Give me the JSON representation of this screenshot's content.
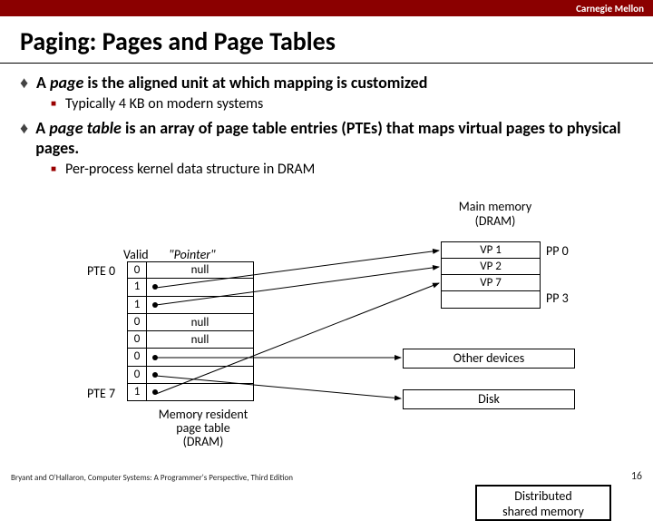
{
  "brand": "Carnegie Mellon",
  "title": "Paging: Pages and Page Tables",
  "bullets": {
    "b1a_pre": "A ",
    "b1a_em": "page",
    "b1a_post": " is the aligned unit at which mapping is customized",
    "b1a_sub": "Typically 4 KB on modern systems",
    "b1b_pre": "A ",
    "b1b_em": "page table",
    "b1b_post": " is an array of page table entries (PTEs) that maps virtual pages to physical pages.",
    "b1b_sub": "Per-process kernel data structure in DRAM"
  },
  "mm_header": {
    "l1": "Main memory",
    "l2": "(DRAM)"
  },
  "table": {
    "hdr_valid": "Valid",
    "hdr_ptr": "\"Pointer\"",
    "pte0": "PTE 0",
    "pte7": "PTE 7",
    "valid": [
      "0",
      "1",
      "1",
      "0",
      "0",
      "0",
      "0",
      "1"
    ],
    "ptr": [
      "null",
      "",
      "",
      "null",
      "null",
      "",
      "",
      ""
    ]
  },
  "pt_caption": {
    "l1": "Memory resident",
    "l2": "page table",
    "l3": "(DRAM)"
  },
  "mm": {
    "vp1": "VP 1",
    "vp2": "VP 2",
    "vp7": "VP 7",
    "pp0": "PP 0",
    "pp3": "PP 3"
  },
  "other": "Other devices",
  "disk": "Disk",
  "dsm": {
    "l1": "Distributed",
    "l2": "shared memory"
  },
  "footer": "Bryant and O'Hallaron, Computer Systems: A Programmer's Perspective, Third Edition",
  "page": "16"
}
